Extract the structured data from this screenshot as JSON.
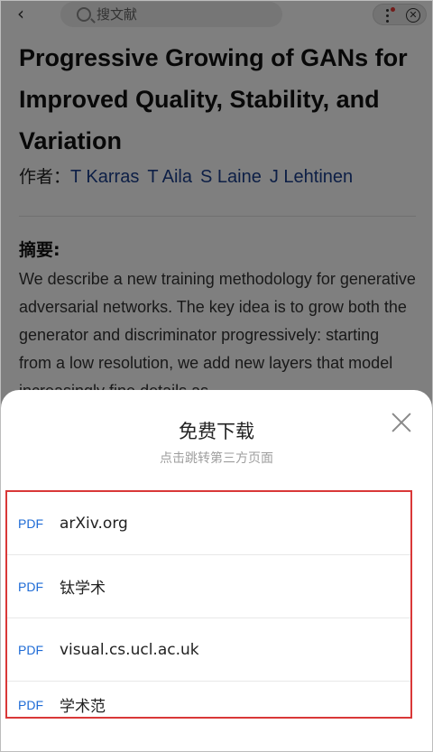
{
  "topbar": {
    "search_placeholder": "搜文献"
  },
  "paper": {
    "title": "Progressive Growing of GANs for Improved Quality, Stability, and Variation",
    "author_label": "作者：",
    "authors": [
      "T Karras",
      "T Aila",
      "S Laine",
      "J Lehtinen"
    ],
    "abstract_label": "摘要:",
    "abstract": "We describe a new training methodology for generative adversarial networks. The key idea is to grow both the generator and discriminator progressively: starting from a low resolution, we add new layers that model increasingly fine details as"
  },
  "sheet": {
    "title": "免费下载",
    "subtitle": "点击跳转第三方页面",
    "sources": [
      {
        "badge": "PDF",
        "name": "arXiv.org"
      },
      {
        "badge": "PDF",
        "name": "钛学术"
      },
      {
        "badge": "PDF",
        "name": "visual.cs.ucl.ac.uk"
      },
      {
        "badge": "PDF",
        "name": "学术范"
      }
    ]
  },
  "colors": {
    "accent": "#1e6bd6",
    "author_link": "#1a3e8c",
    "highlight_border": "#d93838"
  }
}
